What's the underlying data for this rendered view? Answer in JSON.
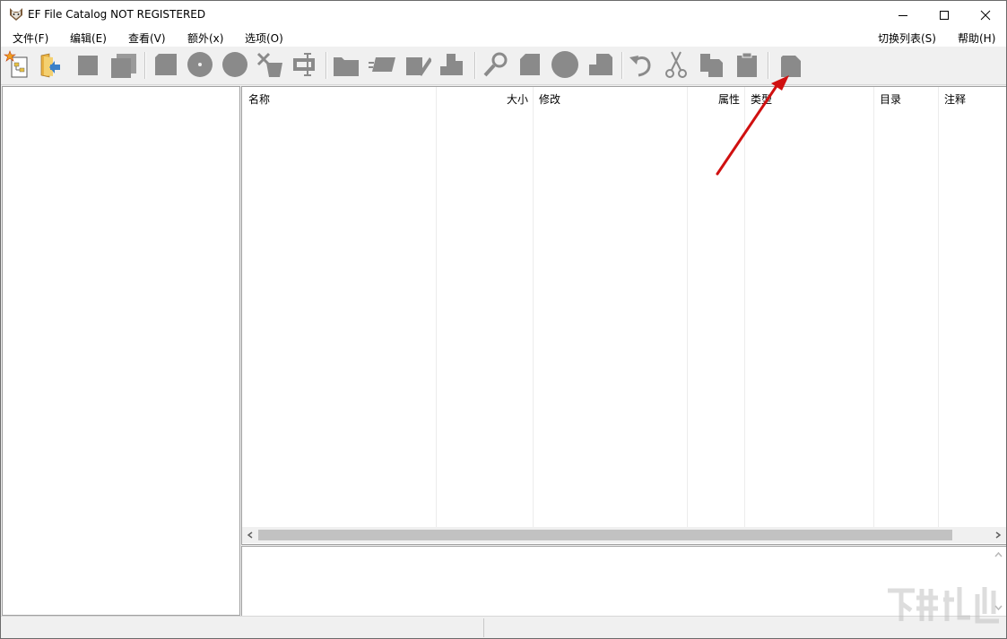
{
  "window": {
    "title": "EF File Catalog NOT REGISTERED",
    "icon": "cat-icon"
  },
  "menu": {
    "file": "文件(F)",
    "edit": "编辑(E)",
    "view": "查看(V)",
    "extra": "额外(x)",
    "options": "选项(O)",
    "toggle_list": "切换列表(S)",
    "help": "帮助(H)"
  },
  "toolbar": {
    "buttons": [
      "new-catalog-icon",
      "open-catalog-icon",
      "save-icon",
      "save-all-icon",
      "add-volume-icon",
      "add-disk-icon",
      "add-cd-icon",
      "remove-icon",
      "rename-volume-icon",
      "folder-icon",
      "tag-icon",
      "edit-entry-icon",
      "properties-icon",
      "search-icon",
      "copy-list-icon",
      "stop-icon",
      "export-icon",
      "undo-icon",
      "cut-icon",
      "copy-icon",
      "paste-icon",
      "new-page-icon"
    ]
  },
  "columns": {
    "name": "名称",
    "size": "大小",
    "modified": "修改",
    "attributes": "属性",
    "type": "类型",
    "directory": "目录",
    "comment": "注释"
  },
  "colors": {
    "titlebar_bg": "#ffffff",
    "chrome_bg": "#f0f0f0",
    "icon_gray": "#8a8a8a",
    "annotation_red": "#d01010"
  }
}
